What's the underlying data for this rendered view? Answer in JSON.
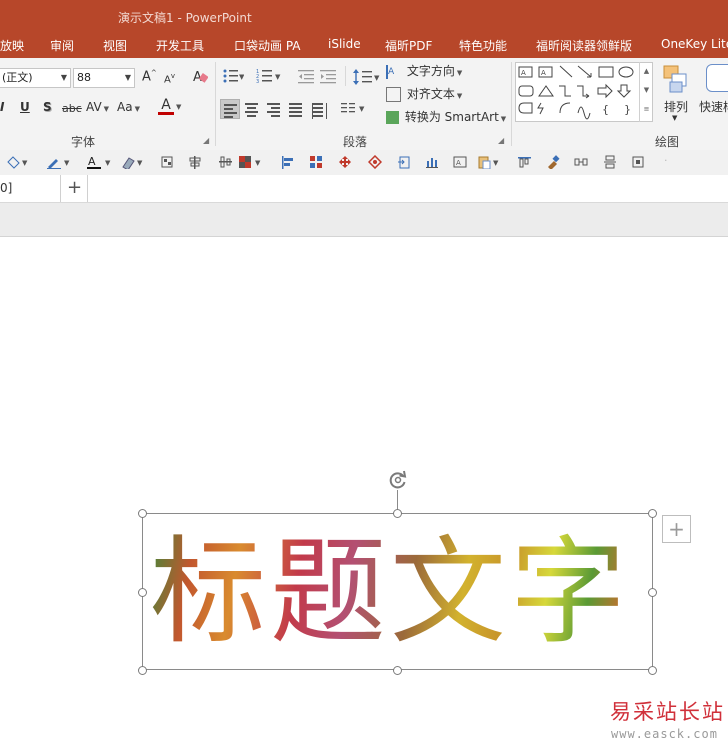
{
  "window": {
    "title": "演示文稿1 - PowerPoint"
  },
  "ribbon_tabs": [
    "放映",
    "审阅",
    "视图",
    "开发工具",
    "口袋动画 PA",
    "iSlide",
    "福昕PDF",
    "特色功能",
    "福昕阅读器领鲜版",
    "OneKey Lite"
  ],
  "font_group": {
    "font_name": "(正文)",
    "font_size": "88",
    "grow_glyph": "A",
    "shrink_glyph": "A",
    "italic": "I",
    "underline": "U",
    "shadow": "S",
    "strike": "abc",
    "spacing": "AV",
    "case": "Aa",
    "color_glyph": "A",
    "label": "字体"
  },
  "paragraph_group": {
    "text_direction": "文字方向",
    "align_text": "对齐文本",
    "smartart": "转换为 SmartArt",
    "label": "段落"
  },
  "drawing_group": {
    "arrange": "排列",
    "quick_styles": "快速样",
    "label": "绘图"
  },
  "slide_tabs": {
    "current": "0]",
    "add": "+"
  },
  "slide": {
    "title_text": "标题文字",
    "insert_plus": "+"
  },
  "watermark": {
    "cn": "易采站长站",
    "url": "www.easck.com"
  },
  "colors": {
    "title_bar": "#b7472a",
    "ribbon_bg": "#f3f3f3",
    "font_color_bar": "#c00000",
    "watermark_red": "#d0303a"
  },
  "icons": [
    "format-painter-icon",
    "bullets-icon",
    "numbering-icon",
    "line-spacing-icon",
    "rotate-icon",
    "shapes-gallery-icon",
    "arrange-icon"
  ]
}
